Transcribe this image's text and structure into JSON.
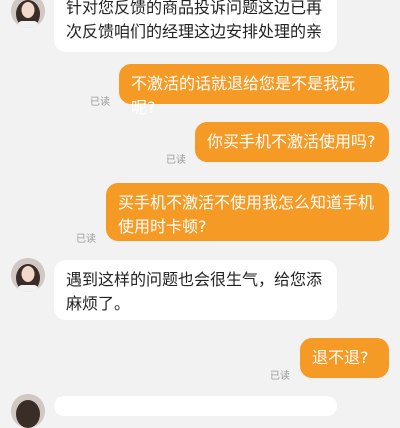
{
  "messages": [
    {
      "side": "in",
      "text": "针对您反馈的商品投诉问题这边已再次反馈咱们的经理这边安排处理的亲"
    },
    {
      "side": "out",
      "text": "不激活的话就退给您是不是我玩呢?",
      "status": "已读"
    },
    {
      "side": "out",
      "text": "你买手机不激活使用吗?",
      "status": "已读"
    },
    {
      "side": "out",
      "text": "买手机不激活不使用我怎么知道手机使用时卡顿?",
      "status": "已读"
    },
    {
      "side": "in",
      "text": "遇到这样的问题也会很生气，给您添麻烦了。"
    },
    {
      "side": "out",
      "text": "退不退?",
      "status": "已读"
    }
  ],
  "icons": {
    "agent_avatar": "agent-avatar-icon"
  },
  "colors": {
    "outgoing_bubble": "#f59a25",
    "incoming_bubble": "#ffffff",
    "background": "#f2f2f2"
  }
}
